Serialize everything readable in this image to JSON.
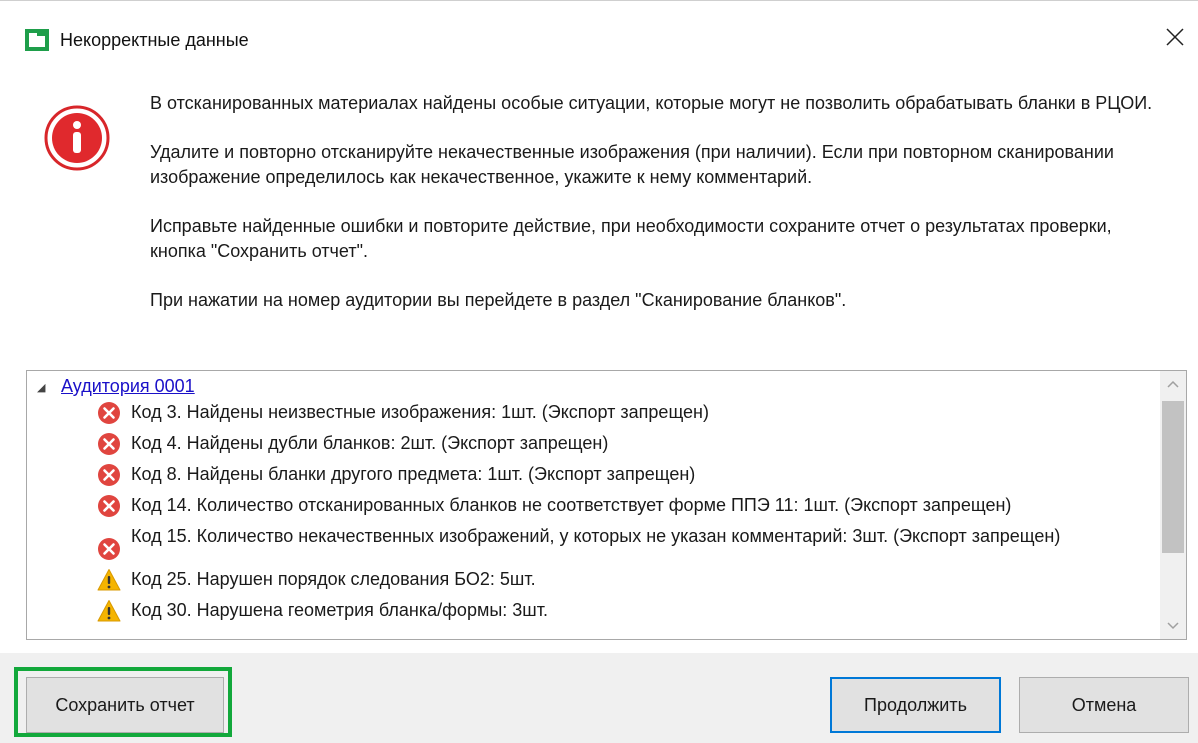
{
  "window": {
    "title": "Некорректные данные",
    "close_symbol": "✕"
  },
  "message": {
    "paragraphs": [
      "В отсканированных материалах найдены особые ситуации, которые могут не позволить обрабатывать бланки в РЦОИ.",
      "Удалите и повторно отсканируйте некачественные изображения (при наличии). Если при повторном сканировании изображение определилось как некачественное, укажите к нему комментарий.",
      "Исправьте найденные ошибки и повторите действие, при необходимости сохраните отчет  о результатах проверки, кнопка \"Сохранить отчет\".",
      "При нажатии на номер аудитории вы перейдете в раздел \"Сканирование бланков\"."
    ]
  },
  "tree": {
    "expand_symbol": "◢",
    "room_label": "Аудитория 0001",
    "items": [
      {
        "type": "error",
        "icon": "error-icon",
        "text": "Код 3. Найдены неизвестные изображения: 1шт. (Экспорт запрещен)"
      },
      {
        "type": "error",
        "icon": "error-icon",
        "text": "Код 4. Найдены дубли бланков: 2шт. (Экспорт запрещен)"
      },
      {
        "type": "error",
        "icon": "error-icon",
        "text": "Код 8. Найдены бланки другого предмета: 1шт. (Экспорт запрещен)"
      },
      {
        "type": "error",
        "icon": "error-icon",
        "text": "Код 14. Количество отсканированных бланков не соответствует форме ППЭ 11: 1шт. (Экспорт запрещен)"
      },
      {
        "type": "error",
        "icon": "error-icon",
        "text": "Код 15. Количество некачественных изображений, у которых не указан комментарий: 3шт. (Экспорт запрещен)"
      },
      {
        "type": "warning",
        "icon": "warning-icon",
        "text": "Код 25. Нарушен порядок следования БО2: 5шт."
      },
      {
        "type": "warning",
        "icon": "warning-icon",
        "text": "Код 30. Нарушена геометрия бланка/формы: 3шт."
      }
    ]
  },
  "buttons": {
    "save_report": "Сохранить отчет",
    "continue": "Продолжить",
    "cancel": "Отмена"
  },
  "colors": {
    "error": "#e0453f",
    "warning": "#f5b400",
    "link": "#1a10c8",
    "highlight": "#12a83b",
    "focus": "#0078d7"
  }
}
